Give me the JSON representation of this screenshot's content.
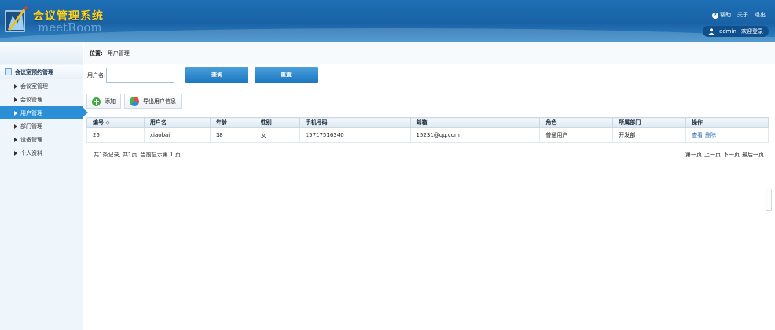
{
  "header": {
    "title": "会议管理系统",
    "subtitle": "meetRoom",
    "nav": {
      "help": "帮助",
      "about": "关于",
      "logout": "退出"
    },
    "user": {
      "name": "admin",
      "welcome": "欢迎登录"
    }
  },
  "sidebar": {
    "group": "会议室预约管理",
    "items": [
      {
        "label": "会议室管理"
      },
      {
        "label": "会议管理"
      },
      {
        "label": "用户管理",
        "active": true
      },
      {
        "label": "部门管理"
      },
      {
        "label": "设备管理"
      },
      {
        "label": "个人资料"
      }
    ]
  },
  "breadcrumb": {
    "label": "位置:",
    "current": "用户管理"
  },
  "search": {
    "label": "用户名:",
    "value": "",
    "placeholder": "",
    "query_label": "查询",
    "reset_label": "重置"
  },
  "toolbar": {
    "add_label": "添加",
    "export_label": "导出用户信息"
  },
  "table": {
    "columns": [
      "编号 ◇",
      "用户名",
      "年龄",
      "性别",
      "手机号码",
      "邮箱",
      "角色",
      "所属部门",
      "操作"
    ],
    "rows": [
      {
        "id": "25",
        "username": "xiaobai",
        "age": "18",
        "gender": "女",
        "phone": "15717516340",
        "email": "15231@qq.com",
        "role": "普通用户",
        "dept": "开发部",
        "view": "查看",
        "delete": "删除"
      }
    ]
  },
  "footer": {
    "summary": "共1条记录, 共1页, 当前显示第 1 页",
    "pager": {
      "first": "第一页",
      "prev": "上一页",
      "next": "下一页",
      "last": "最后一页"
    }
  },
  "colors": {
    "header": "#1a62a6",
    "title": "#ffd21e",
    "accent": "#2b8fd8",
    "button": "#1e78bf"
  }
}
